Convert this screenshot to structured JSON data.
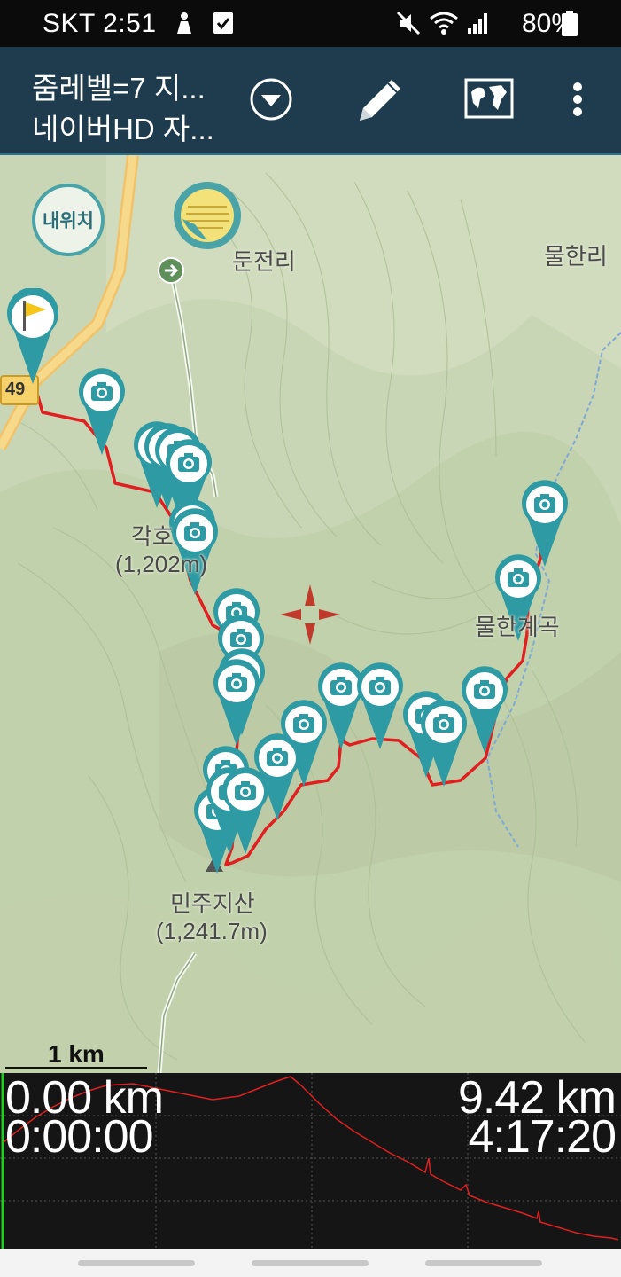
{
  "status_bar": {
    "carrier_time": "SKT 2:51",
    "battery": "80%"
  },
  "toolbar": {
    "line1": "줌레벨=7 지...",
    "line2": "네이버HD 자..."
  },
  "map": {
    "my_location_button": "내위치",
    "road_number": "49",
    "places": {
      "dunjeonri": "둔전리",
      "mulhanri": "물한리",
      "gakho_name": "각호",
      "gakho_elev": "(1,202m)",
      "mulhan_valley": "물한계곡",
      "minjuji_name": "민주지산",
      "minjuji_elev": "(1,241.7m)"
    },
    "scale_label": "1 km"
  },
  "profile": {
    "start_distance": "0.00 km",
    "start_time": "0:00:00",
    "end_distance": "9.42 km",
    "end_time": "4:17:20"
  },
  "colors": {
    "toolbar_bg": "#1e3c4e",
    "track": "#e02020",
    "marker": "#2e9aa3",
    "map_bg": "#c9d6b6"
  }
}
